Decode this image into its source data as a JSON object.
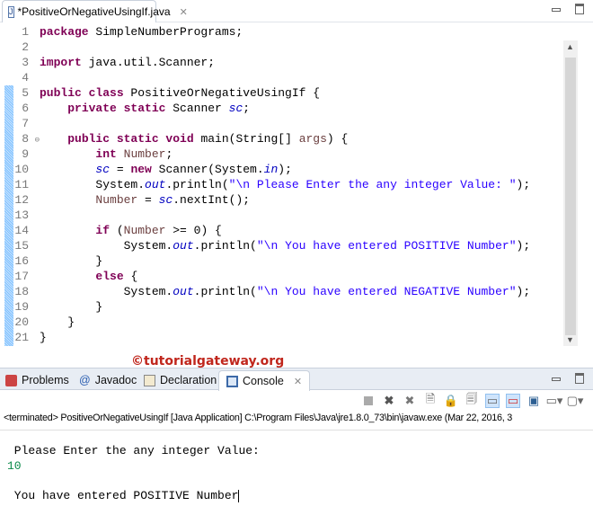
{
  "editor_tab": {
    "title": "*PositiveOrNegativeUsingIf.java",
    "icon": "java-file-icon"
  },
  "code_lines": [
    [
      [
        "kw",
        "package"
      ],
      [
        "pl",
        " SimpleNumberPrograms;"
      ]
    ],
    [],
    [
      [
        "kw",
        "import"
      ],
      [
        "pl",
        " java.util.Scanner;"
      ]
    ],
    [],
    [
      [
        "kw",
        "public class"
      ],
      [
        "pl",
        " PositiveOrNegativeUsingIf {"
      ]
    ],
    [
      [
        "pl",
        "    "
      ],
      [
        "kw",
        "private static"
      ],
      [
        "pl",
        " Scanner "
      ],
      [
        "fld",
        "sc"
      ],
      [
        "pl",
        ";"
      ]
    ],
    [],
    [
      [
        "pl",
        "    "
      ],
      [
        "kw",
        "public static void"
      ],
      [
        "pl",
        " main(String[] "
      ],
      [
        "loc",
        "args"
      ],
      [
        "pl",
        ") {"
      ]
    ],
    [
      [
        "pl",
        "        "
      ],
      [
        "kw",
        "int"
      ],
      [
        "pl",
        " "
      ],
      [
        "loc",
        "Number"
      ],
      [
        "pl",
        ";"
      ]
    ],
    [
      [
        "pl",
        "        "
      ],
      [
        "fld",
        "sc"
      ],
      [
        "pl",
        " = "
      ],
      [
        "kw",
        "new"
      ],
      [
        "pl",
        " Scanner(System."
      ],
      [
        "fld",
        "in"
      ],
      [
        "pl",
        ");"
      ]
    ],
    [
      [
        "pl",
        "        System."
      ],
      [
        "fld",
        "out"
      ],
      [
        "pl",
        ".println("
      ],
      [
        "str",
        "\"\\n Please Enter the any integer Value: \""
      ],
      [
        "pl",
        ");"
      ]
    ],
    [
      [
        "pl",
        "        "
      ],
      [
        "loc",
        "Number"
      ],
      [
        "pl",
        " = "
      ],
      [
        "fld",
        "sc"
      ],
      [
        "pl",
        ".nextInt();"
      ]
    ],
    [],
    [
      [
        "pl",
        "        "
      ],
      [
        "kw",
        "if"
      ],
      [
        "pl",
        " ("
      ],
      [
        "loc",
        "Number"
      ],
      [
        "pl",
        " >= 0) {"
      ]
    ],
    [
      [
        "pl",
        "            System."
      ],
      [
        "fld",
        "out"
      ],
      [
        "pl",
        ".println("
      ],
      [
        "str",
        "\"\\n You have entered POSITIVE Number\""
      ],
      [
        "pl",
        ");"
      ]
    ],
    [
      [
        "pl",
        "        }"
      ]
    ],
    [
      [
        "pl",
        "        "
      ],
      [
        "kw",
        "else"
      ],
      [
        "pl",
        " {"
      ]
    ],
    [
      [
        "pl",
        "            System."
      ],
      [
        "fld",
        "out"
      ],
      [
        "pl",
        ".println("
      ],
      [
        "str",
        "\"\\n You have entered NEGATIVE Number\""
      ],
      [
        "pl",
        ");"
      ]
    ],
    [
      [
        "pl",
        "        }"
      ]
    ],
    [
      [
        "pl",
        "    }"
      ]
    ],
    [
      [
        "pl",
        "}"
      ]
    ]
  ],
  "watermark": "©tutorialgateway.org",
  "panel_tabs": [
    {
      "label": "Problems",
      "icon": "problems-icon"
    },
    {
      "label": "Javadoc",
      "icon": "at-icon"
    },
    {
      "label": "Declaration",
      "icon": "declaration-icon"
    },
    {
      "label": "Console",
      "icon": "console-icon"
    }
  ],
  "terminated_line": "<terminated> PositiveOrNegativeUsingIf [Java Application] C:\\Program Files\\Java\\jre1.8.0_73\\bin\\javaw.exe (Mar 22, 2016, 3",
  "console_output": {
    "line1": " Please Enter the any integer Value:",
    "input": "10",
    "line3": " You have entered POSITIVE Number"
  },
  "colors": {
    "keyword": "#7f0055",
    "string": "#2a00ff",
    "field": "#0000c0",
    "local": "#6a3e3e"
  }
}
